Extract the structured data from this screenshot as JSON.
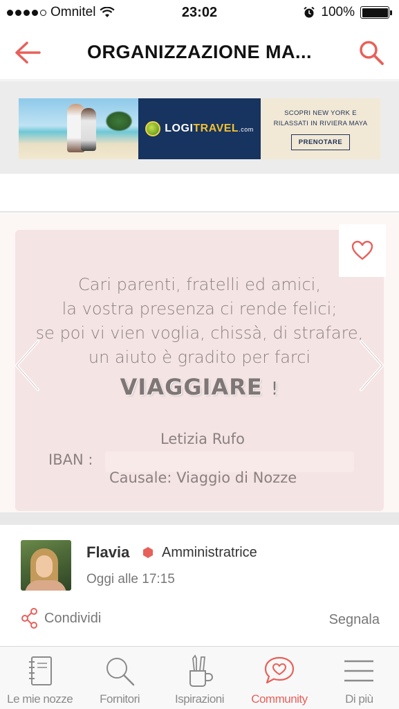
{
  "status_bar": {
    "carrier": "Omnitel",
    "time": "23:02",
    "battery": "100%"
  },
  "nav": {
    "title": "ORGANIZZAZIONE MA..."
  },
  "ad": {
    "brand_logo": "LOGITRAVEL",
    "brand_travel_part": "TRAVEL",
    "brand_logi_part": "LOGI",
    "brand_domain": ".com",
    "cta_text_line1": "SCOPRI NEW YORK E",
    "cta_text_line2": "RILASSATI IN RIVIERA MAYA",
    "cta_button": "PRENOTARE"
  },
  "gallery": {
    "lines": [
      "Cari parenti, fratelli ed amici,",
      "la vostra presenza ci rende felici;",
      "se poi vi vien voglia, chissà, di strafare,",
      "un aiuto è gradito per farci"
    ],
    "highlight": "VIAGGIARE",
    "highlight_suffix": "!",
    "signature": "Letizia Rufo",
    "iban_label": "IBAN :",
    "causale": "Causale: Viaggio di Nozze"
  },
  "author": {
    "name": "Flavia",
    "role": "Amministratrice",
    "time": "Oggi alle 17:15",
    "share_label": "Condividi",
    "report_label": "Segnala"
  },
  "tabs": [
    {
      "label": "Le mie nozze",
      "icon": "notebook-icon",
      "active": false
    },
    {
      "label": "Fornitori",
      "icon": "search-icon",
      "active": false
    },
    {
      "label": "Ispirazioni",
      "icon": "pencil-cup-icon",
      "active": false
    },
    {
      "label": "Community",
      "icon": "chat-heart-icon",
      "active": true
    },
    {
      "label": "Di più",
      "icon": "menu-icon",
      "active": false
    }
  ],
  "colors": {
    "accent": "#e8605a",
    "text": "#333333",
    "muted": "#777777",
    "banner_navy": "#17335f"
  }
}
